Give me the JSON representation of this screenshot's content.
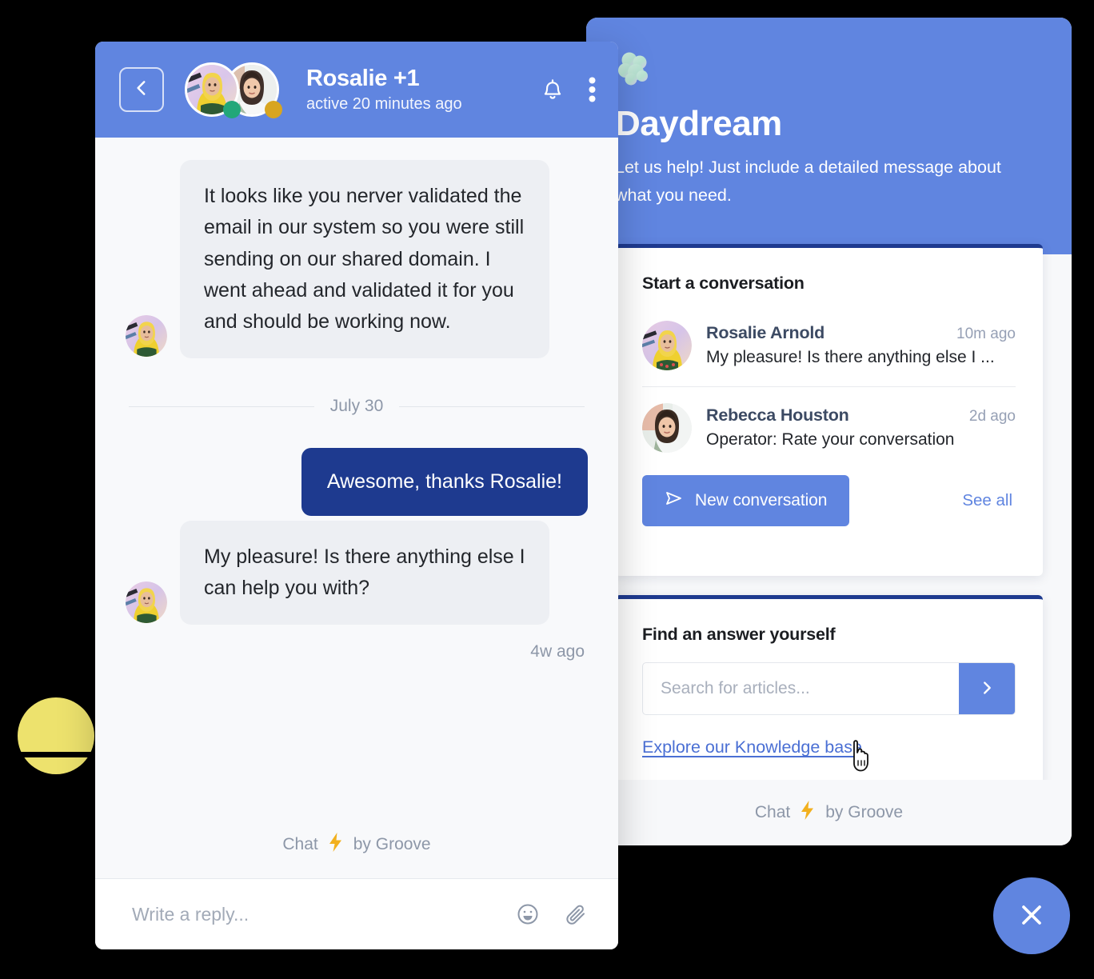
{
  "chat_panel": {
    "header": {
      "back_icon": "chevron-left-icon",
      "title": "Rosalie +1",
      "status": "active 20 minutes ago",
      "bell_icon": "bell-icon",
      "menu_icon": "more-vertical-icon",
      "presence": [
        "online-green",
        "away-yellow"
      ]
    },
    "messages": [
      {
        "direction": "incoming",
        "text": "It looks like you nerver validated the email in our system so you were still sending on our shared domain. I went ahead and validated it for you and should be working now."
      },
      {
        "direction": "outgoing",
        "text": "Awesome, thanks Rosalie!"
      },
      {
        "direction": "incoming",
        "text": "My pleasure! Is there anything else I can help you with?"
      }
    ],
    "date_divider": "July 30",
    "timestamp": "4w ago",
    "brand": {
      "prefix": "Chat",
      "bolt_icon": "lightning-bolt-icon",
      "suffix": "by Groove"
    },
    "composer": {
      "placeholder": "Write a reply...",
      "value": "",
      "emoji_icon": "emoji-icon",
      "attach_icon": "paperclip-icon"
    }
  },
  "widget_panel": {
    "logo_icon": "cloud-cluster-logo",
    "title": "Daydream",
    "subtitle": "Let us help! Just include a detailed message about what you need.",
    "conversations_card": {
      "title": "Start a conversation",
      "items": [
        {
          "name": "Rosalie Arnold",
          "time": "10m ago",
          "preview": "My pleasure! Is there anything else I ..."
        },
        {
          "name": "Rebecca Houston",
          "time": "2d ago",
          "preview": "Operator:  Rate your conversation"
        }
      ],
      "new_conversation_label": "New conversation",
      "new_conversation_icon": "send-icon",
      "see_all_label": "See all"
    },
    "search_card": {
      "title": "Find an answer yourself",
      "search_placeholder": "Search for articles...",
      "search_value": "",
      "submit_icon": "chevron-right-icon",
      "kb_link_label": "Explore our Knowledge base"
    },
    "brand": {
      "prefix": "Chat",
      "bolt_icon": "lightning-bolt-icon",
      "suffix": "by Groove"
    }
  },
  "fab": {
    "icon": "close-icon"
  },
  "colors": {
    "brand_blue": "#6085E0",
    "deep_navy": "#1E3A8F",
    "incoming_bubble": "#EDEFF3",
    "chat_bg": "#F8F9FB",
    "muted_text": "#8D97A8",
    "accent_yellow": "#EDE26D",
    "status_online": "#22A779",
    "status_away": "#D8A520"
  }
}
